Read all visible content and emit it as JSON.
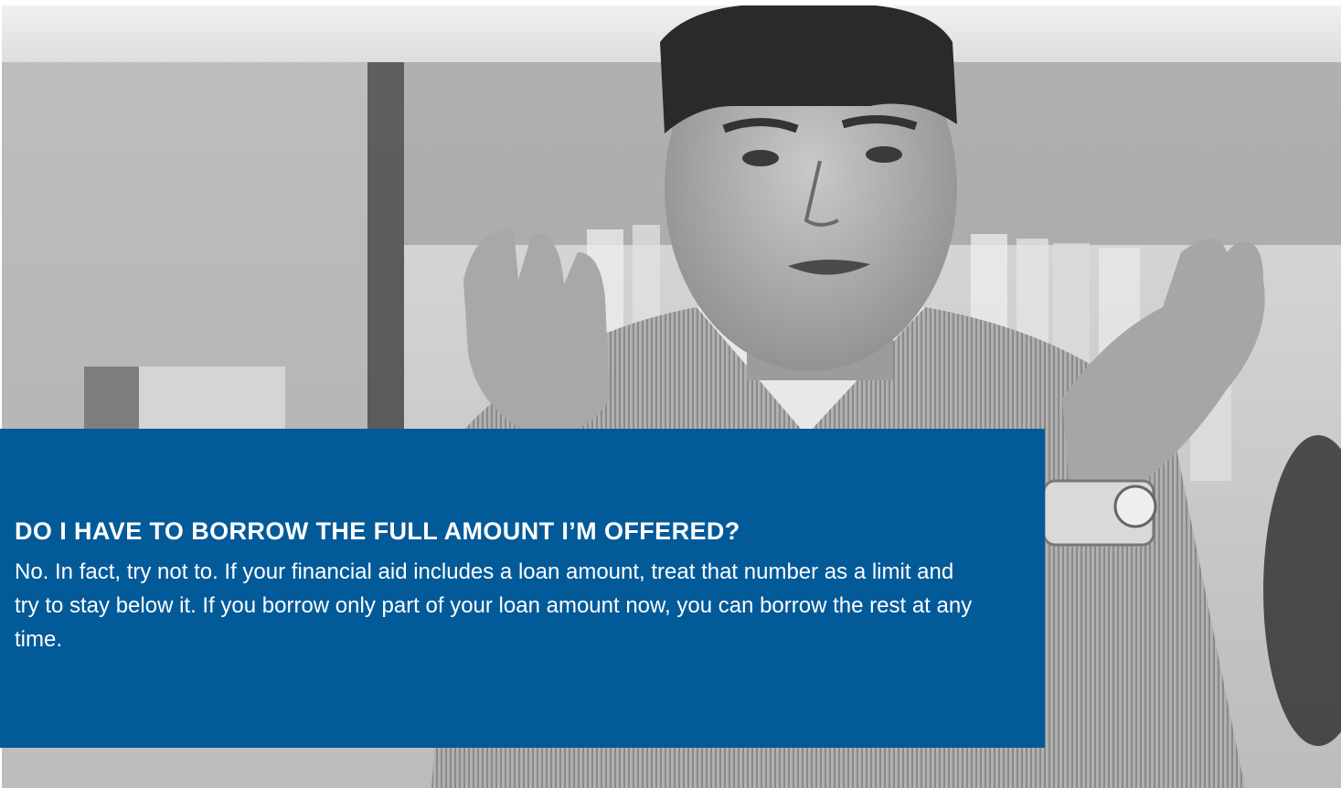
{
  "hero": {
    "image_icon": "person-photo",
    "image_style": "grayscale"
  },
  "faq": {
    "question": "DO I HAVE TO BORROW THE FULL AMOUNT I’M OFFERED?",
    "answer": "No. In fact, try not to. If your financial aid includes a loan amount, treat that number as a limit and try to stay below it. If you borrow only part of your loan amount now, you can borrow the rest at any time.",
    "panel_color": "#025a99"
  }
}
